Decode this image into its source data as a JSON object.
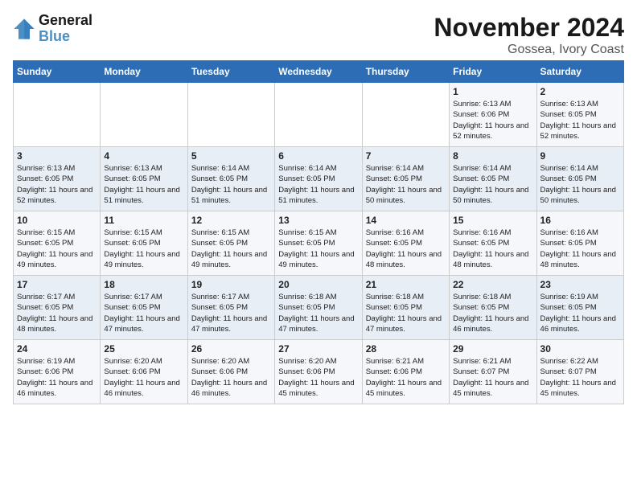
{
  "logo": {
    "text_general": "General",
    "text_blue": "Blue"
  },
  "title": "November 2024",
  "subtitle": "Gossea, Ivory Coast",
  "days_of_week": [
    "Sunday",
    "Monday",
    "Tuesday",
    "Wednesday",
    "Thursday",
    "Friday",
    "Saturday"
  ],
  "weeks": [
    [
      {
        "day": "",
        "info": ""
      },
      {
        "day": "",
        "info": ""
      },
      {
        "day": "",
        "info": ""
      },
      {
        "day": "",
        "info": ""
      },
      {
        "day": "",
        "info": ""
      },
      {
        "day": "1",
        "info": "Sunrise: 6:13 AM\nSunset: 6:06 PM\nDaylight: 11 hours and 52 minutes."
      },
      {
        "day": "2",
        "info": "Sunrise: 6:13 AM\nSunset: 6:05 PM\nDaylight: 11 hours and 52 minutes."
      }
    ],
    [
      {
        "day": "3",
        "info": "Sunrise: 6:13 AM\nSunset: 6:05 PM\nDaylight: 11 hours and 52 minutes."
      },
      {
        "day": "4",
        "info": "Sunrise: 6:13 AM\nSunset: 6:05 PM\nDaylight: 11 hours and 51 minutes."
      },
      {
        "day": "5",
        "info": "Sunrise: 6:14 AM\nSunset: 6:05 PM\nDaylight: 11 hours and 51 minutes."
      },
      {
        "day": "6",
        "info": "Sunrise: 6:14 AM\nSunset: 6:05 PM\nDaylight: 11 hours and 51 minutes."
      },
      {
        "day": "7",
        "info": "Sunrise: 6:14 AM\nSunset: 6:05 PM\nDaylight: 11 hours and 50 minutes."
      },
      {
        "day": "8",
        "info": "Sunrise: 6:14 AM\nSunset: 6:05 PM\nDaylight: 11 hours and 50 minutes."
      },
      {
        "day": "9",
        "info": "Sunrise: 6:14 AM\nSunset: 6:05 PM\nDaylight: 11 hours and 50 minutes."
      }
    ],
    [
      {
        "day": "10",
        "info": "Sunrise: 6:15 AM\nSunset: 6:05 PM\nDaylight: 11 hours and 49 minutes."
      },
      {
        "day": "11",
        "info": "Sunrise: 6:15 AM\nSunset: 6:05 PM\nDaylight: 11 hours and 49 minutes."
      },
      {
        "day": "12",
        "info": "Sunrise: 6:15 AM\nSunset: 6:05 PM\nDaylight: 11 hours and 49 minutes."
      },
      {
        "day": "13",
        "info": "Sunrise: 6:15 AM\nSunset: 6:05 PM\nDaylight: 11 hours and 49 minutes."
      },
      {
        "day": "14",
        "info": "Sunrise: 6:16 AM\nSunset: 6:05 PM\nDaylight: 11 hours and 48 minutes."
      },
      {
        "day": "15",
        "info": "Sunrise: 6:16 AM\nSunset: 6:05 PM\nDaylight: 11 hours and 48 minutes."
      },
      {
        "day": "16",
        "info": "Sunrise: 6:16 AM\nSunset: 6:05 PM\nDaylight: 11 hours and 48 minutes."
      }
    ],
    [
      {
        "day": "17",
        "info": "Sunrise: 6:17 AM\nSunset: 6:05 PM\nDaylight: 11 hours and 48 minutes."
      },
      {
        "day": "18",
        "info": "Sunrise: 6:17 AM\nSunset: 6:05 PM\nDaylight: 11 hours and 47 minutes."
      },
      {
        "day": "19",
        "info": "Sunrise: 6:17 AM\nSunset: 6:05 PM\nDaylight: 11 hours and 47 minutes."
      },
      {
        "day": "20",
        "info": "Sunrise: 6:18 AM\nSunset: 6:05 PM\nDaylight: 11 hours and 47 minutes."
      },
      {
        "day": "21",
        "info": "Sunrise: 6:18 AM\nSunset: 6:05 PM\nDaylight: 11 hours and 47 minutes."
      },
      {
        "day": "22",
        "info": "Sunrise: 6:18 AM\nSunset: 6:05 PM\nDaylight: 11 hours and 46 minutes."
      },
      {
        "day": "23",
        "info": "Sunrise: 6:19 AM\nSunset: 6:05 PM\nDaylight: 11 hours and 46 minutes."
      }
    ],
    [
      {
        "day": "24",
        "info": "Sunrise: 6:19 AM\nSunset: 6:06 PM\nDaylight: 11 hours and 46 minutes."
      },
      {
        "day": "25",
        "info": "Sunrise: 6:20 AM\nSunset: 6:06 PM\nDaylight: 11 hours and 46 minutes."
      },
      {
        "day": "26",
        "info": "Sunrise: 6:20 AM\nSunset: 6:06 PM\nDaylight: 11 hours and 46 minutes."
      },
      {
        "day": "27",
        "info": "Sunrise: 6:20 AM\nSunset: 6:06 PM\nDaylight: 11 hours and 45 minutes."
      },
      {
        "day": "28",
        "info": "Sunrise: 6:21 AM\nSunset: 6:06 PM\nDaylight: 11 hours and 45 minutes."
      },
      {
        "day": "29",
        "info": "Sunrise: 6:21 AM\nSunset: 6:07 PM\nDaylight: 11 hours and 45 minutes."
      },
      {
        "day": "30",
        "info": "Sunrise: 6:22 AM\nSunset: 6:07 PM\nDaylight: 11 hours and 45 minutes."
      }
    ]
  ]
}
